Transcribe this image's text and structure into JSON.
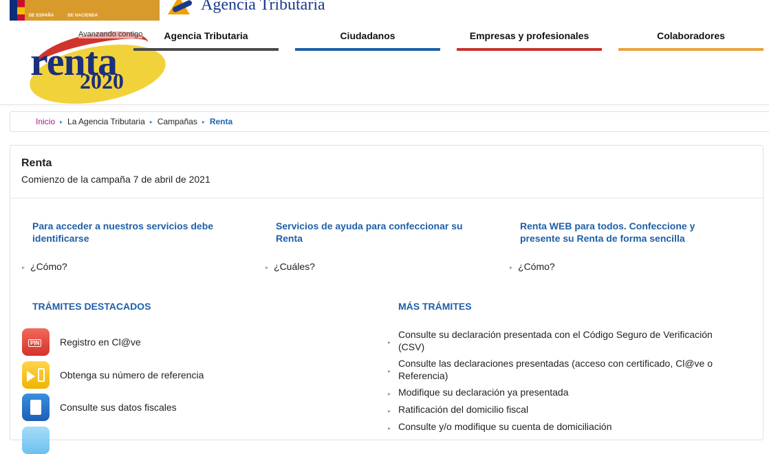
{
  "header": {
    "gov_text_1": "DE ESPAÑA",
    "gov_text_2": "DE HACIENDA",
    "agency_name": "Agencia Tributaria"
  },
  "renta_logo": {
    "slogan": "Avanzando contigo",
    "word": "renta",
    "year": "2020"
  },
  "nav": {
    "items": [
      {
        "label": "Agencia Tributaria",
        "color": "#4a4a4a"
      },
      {
        "label": "Ciudadanos",
        "color": "#1d5fa8"
      },
      {
        "label": "Empresas y profesionales",
        "color": "#c9302c"
      },
      {
        "label": "Colaboradores",
        "color": "#e9a23b"
      }
    ]
  },
  "breadcrumb": {
    "items": [
      "Inicio",
      "La Agencia Tributaria",
      "Campañas",
      "Renta"
    ]
  },
  "page": {
    "title": "Renta",
    "subtitle": "Comienzo de la campaña 7 de abril de 2021"
  },
  "features": [
    {
      "title": "Para acceder a nuestros servicios debe identificarse",
      "link": "¿Cómo?"
    },
    {
      "title": "Servicios de ayuda para confeccionar su Renta",
      "link": "¿Cuáles?"
    },
    {
      "title": "Renta WEB para todos. Confeccione y presente su Renta de forma sencilla",
      "link": "¿Cómo?"
    }
  ],
  "tramites_destacados": {
    "title": "TRÁMITES DESTACADOS",
    "items": [
      {
        "label": "Registro en Cl@ve",
        "icon": "pin-icon"
      },
      {
        "label": "Obtenga su número de referencia",
        "icon": "reference-number-icon"
      },
      {
        "label": "Consulte sus datos fiscales",
        "icon": "tax-data-icon"
      }
    ]
  },
  "mas_tramites": {
    "title": "MÁS TRÁMITES",
    "items": [
      "Consulte su declaración presentada con el Código Seguro de Verificación (CSV)",
      "Consulte las declaraciones presentadas (acceso con certificado, Cl@ve o Referencia)",
      "Modifique su declaración ya presentada",
      "Ratificación del domicilio fiscal",
      "Consulte y/o modifique su cuenta de domiciliación"
    ]
  },
  "icons": {
    "list_arrow": "▸"
  }
}
